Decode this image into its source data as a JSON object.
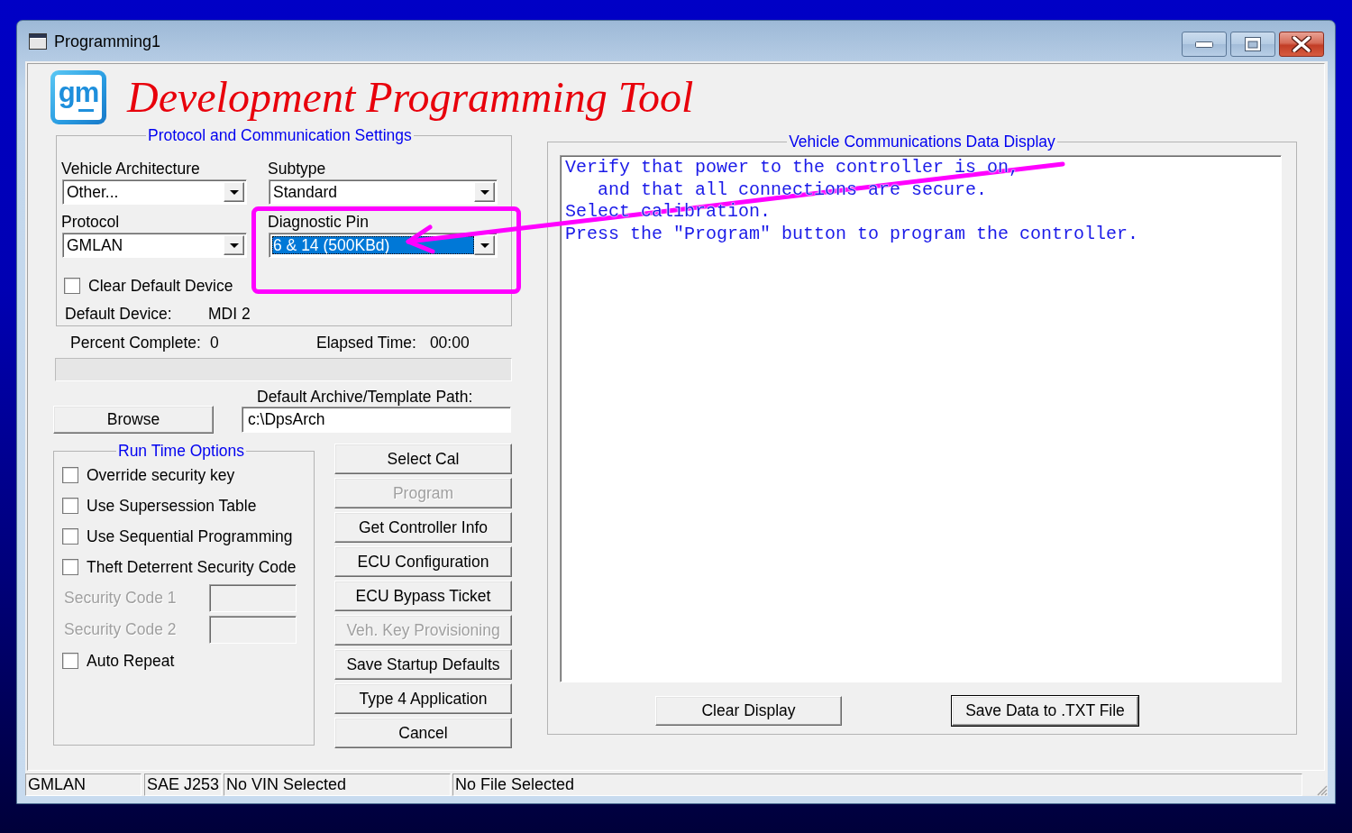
{
  "window": {
    "title": "Programming1"
  },
  "header": {
    "logo_text": "gm",
    "title": "Development Programming Tool"
  },
  "protocol_settings": {
    "title": "Protocol and Communication Settings",
    "dropdowns": [
      {
        "label": "Vehicle Architecture",
        "value": "Other...",
        "focused": false
      },
      {
        "label": "Subtype",
        "value": "Standard",
        "focused": false
      },
      {
        "label": "Protocol",
        "value": "GMLAN",
        "focused": false
      },
      {
        "label": "Diagnostic Pin",
        "value": "6 & 14 (500KBd)",
        "focused": true
      }
    ],
    "clear_default_device": {
      "label": "Clear Default Device",
      "checked": false
    },
    "default_device": {
      "label": "Default Device:",
      "value": "MDI 2"
    }
  },
  "progress": {
    "percent_label": "Percent Complete:",
    "percent_value": "0",
    "elapsed_label": "Elapsed Time:",
    "elapsed_value": "00:00"
  },
  "archive": {
    "browse_button": "Browse",
    "path_label": "Default Archive/Template Path:",
    "path_value": "c:\\DpsArch"
  },
  "run_time_options": {
    "title": "Run Time Options",
    "items": [
      {
        "kind": "checkbox",
        "label": "Override security key",
        "checked": false
      },
      {
        "kind": "checkbox",
        "label": "Use Supersession Table",
        "checked": false
      },
      {
        "kind": "checkbox",
        "label": "Use Sequential Programming",
        "checked": false
      },
      {
        "kind": "checkbox",
        "label": "Theft Deterrent Security Code",
        "checked": false
      },
      {
        "kind": "field",
        "label": "Security Code 1",
        "disabled": true
      },
      {
        "kind": "field",
        "label": "Security Code 2",
        "disabled": true
      },
      {
        "kind": "checkbox",
        "label": "Auto Repeat",
        "checked": false
      }
    ]
  },
  "actions": [
    {
      "label": "Select Cal",
      "disabled": false
    },
    {
      "label": "Program",
      "disabled": true
    },
    {
      "label": "Get Controller Info",
      "disabled": false
    },
    {
      "label": "ECU Configuration",
      "disabled": false
    },
    {
      "label": "ECU Bypass Ticket",
      "disabled": false
    },
    {
      "label": "Veh. Key Provisioning",
      "disabled": true
    },
    {
      "label": "Save Startup Defaults",
      "disabled": false
    },
    {
      "label": "Type 4 Application",
      "disabled": false
    },
    {
      "label": "Cancel",
      "disabled": false
    }
  ],
  "data_display": {
    "title": "Vehicle Communications Data Display",
    "lines": [
      "Verify that power to the controller is on,",
      "   and that all connections are secure.",
      "Select calibration.",
      "Press the \"Program\" button to program the controller."
    ],
    "buttons": [
      {
        "label": "Clear Display",
        "default": false
      },
      {
        "label": "Save Data to .TXT File",
        "default": true
      }
    ]
  },
  "status_bar": [
    "GMLAN",
    "SAE J253",
    "No VIN Selected",
    "No File Selected"
  ],
  "annotations": {
    "highlight_box": true,
    "arrow": true
  }
}
